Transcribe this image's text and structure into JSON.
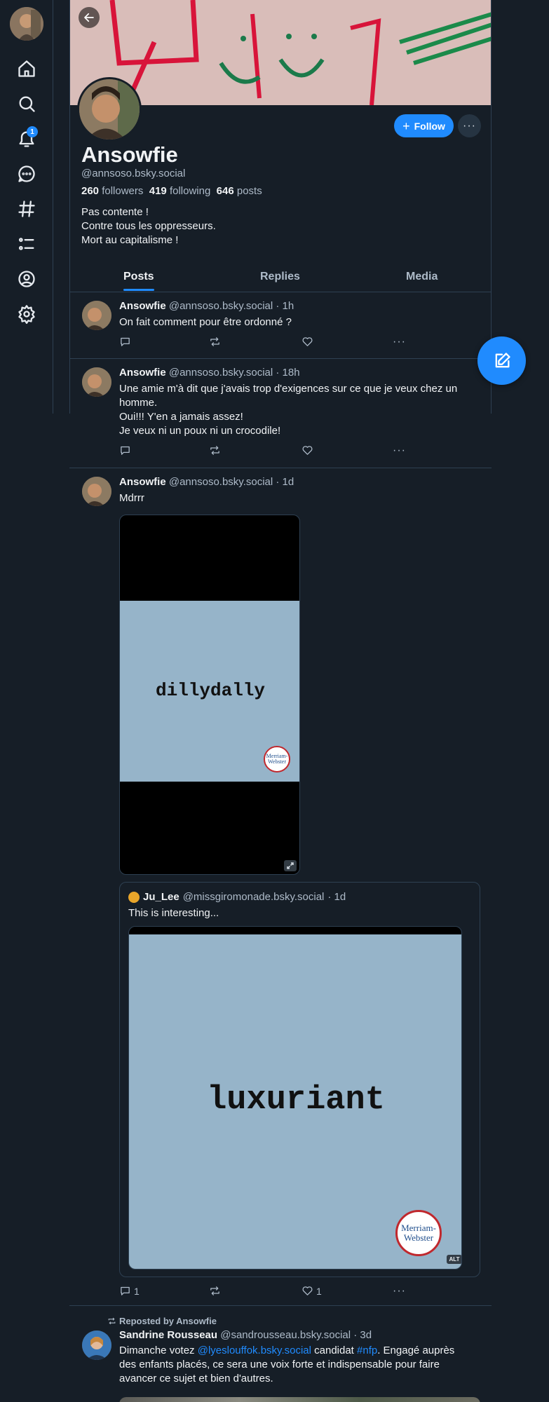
{
  "sidebar": {
    "notifications_badge": "1",
    "items": [
      {
        "name": "home-icon"
      },
      {
        "name": "search-icon"
      },
      {
        "name": "bell-icon"
      },
      {
        "name": "chat-icon"
      },
      {
        "name": "hashtag-icon"
      },
      {
        "name": "list-icon"
      },
      {
        "name": "profile-icon"
      },
      {
        "name": "gear-icon"
      }
    ]
  },
  "profile": {
    "name": "Ansowfie",
    "handle": "@annsoso.bsky.social",
    "followers_count": "260",
    "followers_label": "followers",
    "following_count": "419",
    "following_label": "following",
    "posts_count": "646",
    "posts_label": "posts",
    "bio": [
      "Pas contente !",
      "Contre tous les oppresseurs.",
      "Mort au capitalisme !"
    ],
    "follow_label": "Follow",
    "more_label": "···"
  },
  "tabs": [
    {
      "label": "Posts",
      "active": true
    },
    {
      "label": "Replies",
      "active": false
    },
    {
      "label": "Media",
      "active": false
    }
  ],
  "posts": [
    {
      "author": "Ansowfie",
      "handle": "@annsoso.bsky.social",
      "time": "· 1h",
      "text": [
        "On fait comment pour être ordonné ?"
      ]
    },
    {
      "author": "Ansowfie",
      "handle": "@annsoso.bsky.social",
      "time": "· 18h",
      "text": [
        "Une amie m'à dit que j'avais trop d'exigences sur ce que je veux chez un",
        "homme.",
        "Oui!!! Y'en a jamais assez!",
        "Je veux ni un poux ni un crocodile!"
      ]
    },
    {
      "author": "Ansowfie",
      "handle": "@annsoso.bsky.social",
      "time": "· 1d",
      "text": [
        "Mdrrr"
      ],
      "media_word": "dillydally",
      "logo_text": [
        "Merriam-",
        "Webster"
      ],
      "quote": {
        "author": "Ju_Lee",
        "handle": "@missgiromonade.bsky.social",
        "time": "· 1d",
        "text": "This is interesting...",
        "media_word": "luxuriant",
        "alt_label": "ALT"
      },
      "reply_count": "1",
      "like_count": "1"
    },
    {
      "repost_label": "Reposted by Ansowfie",
      "author": "Sandrine Rousseau",
      "handle": "@sandrousseau.bsky.social",
      "time": "· 3d",
      "text_before": "Dimanche votez ",
      "mention": "@lyeslouffok.bsky.social",
      "text_mid": " candidat ",
      "hashtag": "#nfp",
      "text_after": ". Engagé auprès",
      "text_lines": [
        "des enfants placés, ce sera une voix forte et indispensable pour faire",
        "avancer ce sujet et bien d'autres."
      ]
    }
  ],
  "colors": {
    "background": "#161e27",
    "accent": "#208bfe",
    "border": "#2e4052",
    "muted_text": "#aebbc9",
    "media_card": "#96b4c9"
  }
}
